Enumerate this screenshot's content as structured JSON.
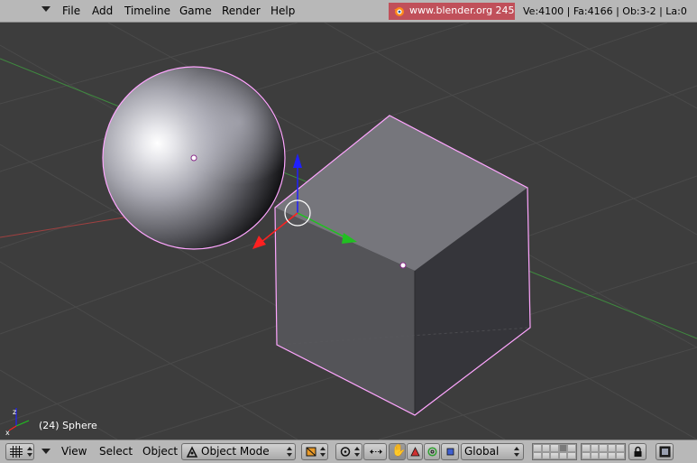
{
  "info_header": {
    "menus": [
      "File",
      "Add",
      "Timeline",
      "Game",
      "Render",
      "Help"
    ],
    "release_url": "www.blender.org 245",
    "stats": "Ve:4100 | Fa:4166 | Ob:3-2 | La:0"
  },
  "viewport": {
    "active_object_label": "(24) Sphere",
    "axis_colors": {
      "x": "#ff2020",
      "y": "#20c020",
      "z": "#2020ff"
    },
    "selection_color": "#ffa6ff"
  },
  "view3d_header": {
    "menus": [
      "View",
      "Select",
      "Object"
    ],
    "mode": "Object Mode",
    "orientation": "Global",
    "icons": [
      "grid-editor-icon",
      "pivot-icon",
      "proportional-icon",
      "manipulator-hand-icon",
      "manipulator-translate-icon",
      "manipulator-rotate-icon",
      "manipulator-scale-icon",
      "lock-icon",
      "render-icon"
    ]
  },
  "colors": {
    "header_bg": "#b8b8b8",
    "viewport_bg": "#3d3d3d",
    "release_bg": "#c0505a"
  }
}
